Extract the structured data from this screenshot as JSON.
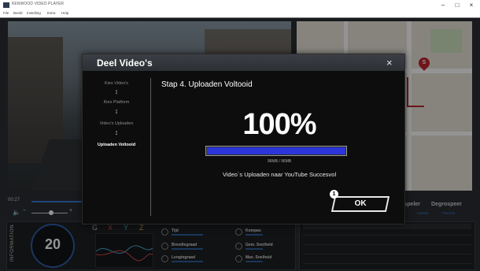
{
  "window": {
    "title": "KENWOOD VIDEO PLAYER",
    "controls": {
      "minimize": "–",
      "maximize": "□",
      "close": "×"
    }
  },
  "menu": [
    "File",
    "Beeld",
    "Instelling",
    "Extra",
    "Help"
  ],
  "player": {
    "time": "00:27",
    "progress": 0.22,
    "volume": 0.6,
    "tabs": [
      "Afspeler",
      "Degrospeer"
    ],
    "subtabs": [
      "Laatste",
      "Favoriet"
    ]
  },
  "info": {
    "label": "INFORMATION",
    "speed": "20",
    "axes": [
      "G",
      "X",
      "Y",
      "Z"
    ],
    "fields": {
      "time": "Tijd",
      "lat": "Breedtegraad",
      "lon": "Lengtegraad",
      "compass": "Kompas",
      "avg_speed": "Gem. Snelheid",
      "max_speed": "Max. Snelheid"
    }
  },
  "map": {
    "pin_label": "S"
  },
  "dialog": {
    "title": "Deel Video's",
    "close": "×",
    "steps": [
      "Kies Video's",
      "Kies Platform",
      "Video's Uploaden",
      "Uploaden Voltooid"
    ],
    "active_step": 3,
    "step_title": "Stap 4. Uploaden Voltooid",
    "percent": "100%",
    "progress": 1.0,
    "size": "96MB / 96MB",
    "message": "Video`s Uploaden naar YouTube Succesvol",
    "ok_label": "OK",
    "badge": "1"
  },
  "colors": {
    "accent": "#2c36d9",
    "dialog_bg": "#0d0d0d",
    "pin": "#c0262e",
    "link_blue": "#3a7bd5"
  }
}
